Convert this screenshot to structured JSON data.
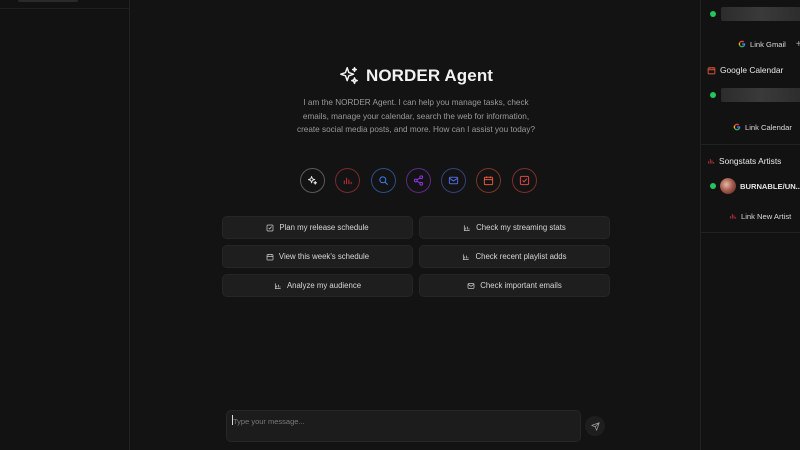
{
  "header": {
    "title": "NORDER Agent",
    "intro": "I am the NORDER Agent. I can help you manage tasks, check emails, manage your calendar, search the web for information, create social media posts, and more. How can I assist you today?"
  },
  "capability_icons": [
    {
      "name": "sparkle-icon",
      "color": "#e5e5e5"
    },
    {
      "name": "bar-chart-icon",
      "color": "#c0303a"
    },
    {
      "name": "search-icon",
      "color": "#3b82f6"
    },
    {
      "name": "share-icon",
      "color": "#9333ea"
    },
    {
      "name": "mail-icon",
      "color": "#4f6bd8"
    },
    {
      "name": "calendar-icon",
      "color": "#e0553a"
    },
    {
      "name": "edit-icon",
      "color": "#d94848"
    }
  ],
  "suggestions": [
    {
      "label": "Plan my release schedule",
      "icon": "checkbox-icon"
    },
    {
      "label": "Check my streaming stats",
      "icon": "bar-chart-icon"
    },
    {
      "label": "View this week's schedule",
      "icon": "calendar-icon"
    },
    {
      "label": "Check recent playlist adds",
      "icon": "bar-chart-icon"
    },
    {
      "label": "Analyze my audience",
      "icon": "bar-chart-icon"
    },
    {
      "label": "Check important emails",
      "icon": "mail-icon"
    }
  ],
  "composer": {
    "placeholder": "Type your message..."
  },
  "integrations": {
    "gmail": {
      "link_label": "Link Gmail"
    },
    "calendar": {
      "title": "Google Calendar",
      "link_label": "Link Calendar"
    },
    "songstats": {
      "title": "Songstats Artists",
      "artist_name": "BURNABLE/UN...",
      "link_label": "Link New Artist"
    }
  },
  "colors": {
    "status_connected": "#22c55e",
    "calendar_accent": "#e0553a",
    "songstats_accent": "#c0303a"
  }
}
